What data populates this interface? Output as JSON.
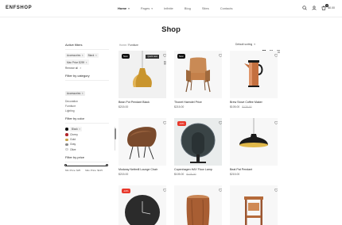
{
  "header": {
    "logo": "ENFSHOP",
    "nav": [
      {
        "label": "Home",
        "has_caret": true,
        "active": true
      },
      {
        "label": "Pages",
        "has_caret": true,
        "active": false
      },
      {
        "label": "Infinite",
        "has_caret": false,
        "active": false
      },
      {
        "label": "Blog",
        "has_caret": false,
        "active": false
      },
      {
        "label": "Sites",
        "has_caret": false,
        "active": false
      },
      {
        "label": "Contacts",
        "has_caret": false,
        "active": false
      }
    ],
    "cart_count": "0",
    "cart_total": "$0.00",
    "icons": [
      "search-icon",
      "user-icon",
      "cart-icon"
    ]
  },
  "page_title": "Shop",
  "breadcrumb": {
    "home": "Home",
    "sep": "/",
    "current": "Furniture"
  },
  "sort": {
    "label": "Default sorting",
    "icon": "chevron-down-icon"
  },
  "sidebar": {
    "active_filters": {
      "title": "Active filters",
      "chips": [
        "Accessories",
        "Black",
        "Max Price $259"
      ],
      "remove_all": "Remove all"
    },
    "category": {
      "title": "Filter by category",
      "items": [
        "Accessories",
        "Decoration",
        "Furniture",
        "Lighting"
      ]
    },
    "color": {
      "title": "Filter by color",
      "items": [
        {
          "label": "Black",
          "color": "#111111"
        },
        {
          "label": "Cherry",
          "color": "#b3262c"
        },
        {
          "label": "Gold",
          "color": "#c9a34a"
        },
        {
          "label": "Gray",
          "color": "#8a8a8a"
        },
        {
          "label": "Olive",
          "color": "#f0f0f0"
        }
      ]
    },
    "price": {
      "title": "Filter by price",
      "min_label": "Min Price: $25",
      "max_label": "Max Price: $125",
      "min_fraction": 0.0,
      "max_fraction": 1.0
    }
  },
  "products": [
    {
      "name": "Bean Pot Pendant Black",
      "price": "$215.00",
      "old_price": "",
      "badge": "New",
      "badge_type": "new",
      "quick_view": "Quick view",
      "image": "gold-pendant-lamp"
    },
    {
      "name": "Thonet Haendel Price",
      "price": "$215.00",
      "old_price": "",
      "badge": "New",
      "badge_type": "new",
      "quick_view": "",
      "image": "wood-armchair"
    },
    {
      "name": "Brew Stove Coffee Maker",
      "price": "$105.00",
      "old_price": "$125.00",
      "badge": "",
      "badge_type": "",
      "quick_view": "",
      "image": "copper-coffee-maker"
    },
    {
      "name": "Modway Nettmill Lounge Chair",
      "price": "$215.00",
      "old_price": "",
      "badge": "",
      "badge_type": "",
      "quick_view": "",
      "image": "brown-lounge-chair"
    },
    {
      "name": "Copenhagen HAY Floor Lamp",
      "price": "$105.00",
      "old_price": "$125.00",
      "badge": "-10%",
      "badge_type": "sale",
      "quick_view": "",
      "image": "dark-disc-lamp"
    },
    {
      "name": "Beat Pat Pendant",
      "price": "$215.00",
      "old_price": "",
      "badge": "",
      "badge_type": "",
      "quick_view": "",
      "image": "black-pendant-lamp"
    },
    {
      "name": "",
      "price": "",
      "old_price": "",
      "badge": "-10%",
      "badge_type": "sale",
      "quick_view": "",
      "image": "wall-clock"
    },
    {
      "name": "",
      "price": "",
      "old_price": "",
      "badge": "",
      "badge_type": "",
      "quick_view": "",
      "image": "wood-stool"
    },
    {
      "name": "",
      "price": "",
      "old_price": "",
      "badge": "",
      "badge_type": "",
      "quick_view": "",
      "image": "side-table"
    }
  ]
}
